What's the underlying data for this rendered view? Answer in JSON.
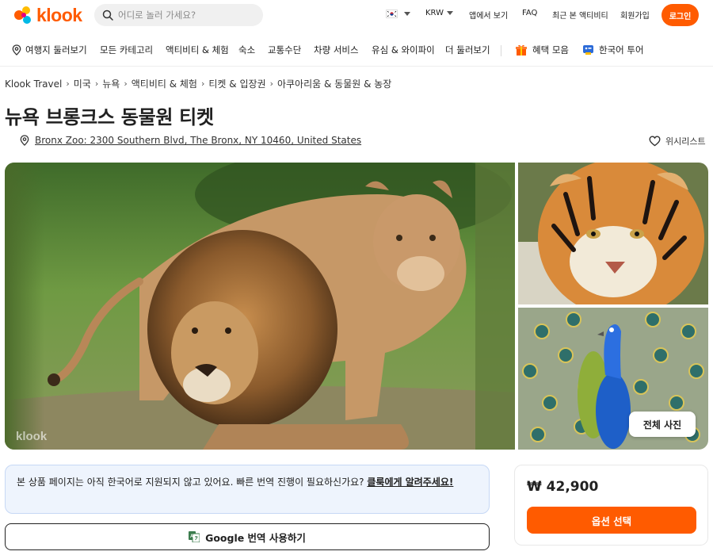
{
  "header": {
    "brand": "klook",
    "search_placeholder": "어디로 놀러 가세요?",
    "currency": "KRW",
    "app_link": "앱에서 보기",
    "faq": "FAQ",
    "recent": "최근 본 액티비티",
    "signup": "회원가입",
    "login": "로그인"
  },
  "nav": {
    "items": [
      "여행지 둘러보기",
      "모든 카테고리",
      "액티비티 & 체험",
      "숙소",
      "교통수단",
      "차량 서비스",
      "유심 & 와이파이",
      "더 둘러보기"
    ],
    "deals": "혜택 모음",
    "korean_tour": "한국어 투어"
  },
  "breadcrumb": [
    "Klook Travel",
    "미국",
    "뉴욕",
    "액티비티 & 체험",
    "티켓 & 입장권",
    "아쿠아리움 & 동물원 & 농장"
  ],
  "product": {
    "title": "뉴욕 브롱크스 동물원 티켓",
    "address": "Bronx Zoo: 2300 Southern Blvd, The Bronx, NY 10460, United States",
    "wishlist": "위시리스트",
    "watermark": "klook",
    "all_photos": "전체 사진"
  },
  "notice": {
    "text": "본 상품 페이지는 아직 한국어로 지원되지 않고 있어요. 빠른 번역 진행이 필요하신가요? ",
    "link": "클룩에게 알려주세요!"
  },
  "translate_button": "Google 번역 사용하기",
  "booking": {
    "price": "₩ 42,900",
    "select_label": "옵션 선택"
  },
  "colors": {
    "brand": "#ff5b00",
    "notice_bg": "#eef4fd"
  }
}
